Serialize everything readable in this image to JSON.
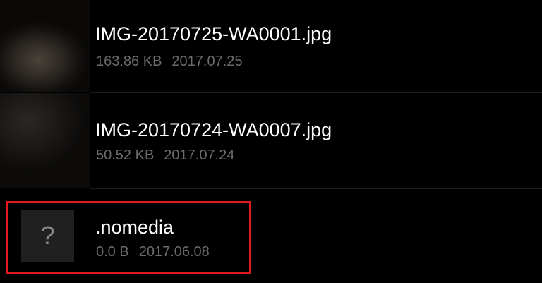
{
  "files": [
    {
      "name": "IMG-20170725-WA0001.jpg",
      "size": "163.86 KB",
      "date": "2017.07.25"
    },
    {
      "name": "IMG-20170724-WA0007.jpg",
      "size": "50.52 KB",
      "date": "2017.07.24"
    },
    {
      "name": ".nomedia",
      "size": "0.0 B",
      "date": "2017.06.08",
      "icon": "unknown-file-icon",
      "icon_glyph": "?"
    }
  ],
  "colors": {
    "background": "#000000",
    "name_text": "#ffffff",
    "meta_text": "#6b6b6b",
    "highlight": "#e4191f"
  }
}
